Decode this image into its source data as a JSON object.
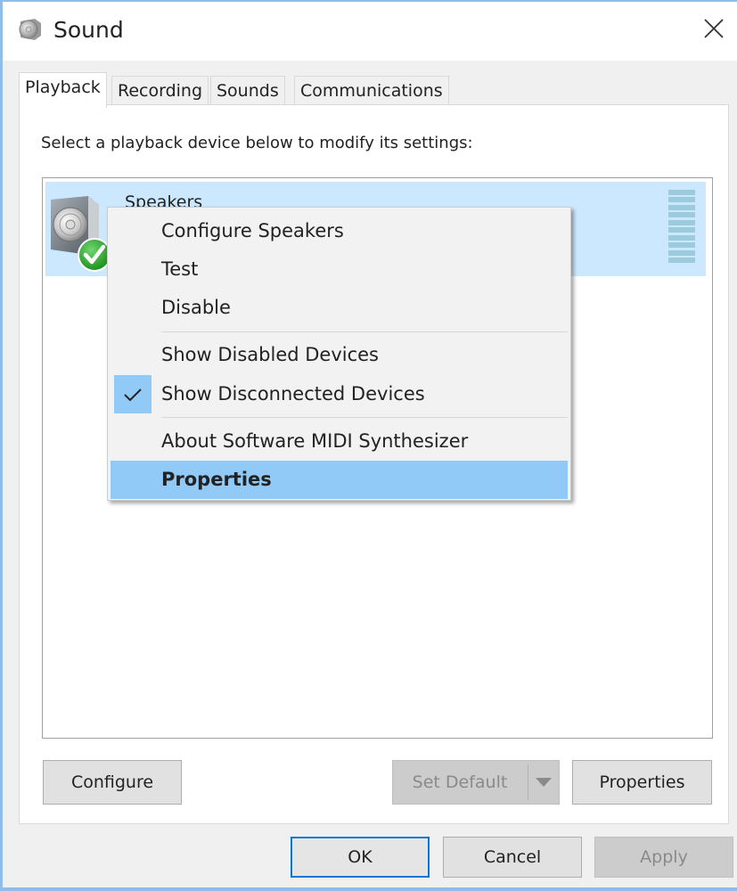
{
  "window": {
    "title": "Sound",
    "title_icon": "speaker-icon",
    "close_icon": "close-icon"
  },
  "tabs": [
    {
      "label": "Playback",
      "active": true
    },
    {
      "label": "Recording",
      "active": false
    },
    {
      "label": "Sounds",
      "active": false
    },
    {
      "label": "Communications",
      "active": false
    }
  ],
  "playback": {
    "instruction": "Select a playback device below to modify its settings:",
    "devices": [
      {
        "name": "Speakers",
        "icon": "speaker-icon",
        "status_icon": "default-device-check-icon",
        "selected": true,
        "level_meter_bars": 10
      }
    ],
    "buttons": {
      "configure": "Configure",
      "set_default": "Set Default",
      "set_default_enabled": false,
      "properties": "Properties"
    }
  },
  "context_menu": {
    "items": [
      {
        "label": "Configure Speakers",
        "checked": false,
        "highlighted": false
      },
      {
        "label": "Test",
        "checked": false,
        "highlighted": false
      },
      {
        "label": "Disable",
        "checked": false,
        "highlighted": false
      },
      {
        "separator": true
      },
      {
        "label": "Show Disabled Devices",
        "checked": false,
        "highlighted": false
      },
      {
        "label": "Show Disconnected Devices",
        "checked": true,
        "highlighted": false
      },
      {
        "separator": true
      },
      {
        "label": "About Software MIDI Synthesizer",
        "checked": false,
        "highlighted": false
      },
      {
        "label": "Properties",
        "checked": false,
        "highlighted": true
      }
    ]
  },
  "footer": {
    "ok": "OK",
    "cancel": "Cancel",
    "apply": "Apply",
    "apply_enabled": false
  },
  "colors": {
    "selection": "#cce8ff",
    "menu_highlight": "#91c9f7",
    "window_border": "#8fbde6",
    "default_button_border": "#0078d7"
  }
}
